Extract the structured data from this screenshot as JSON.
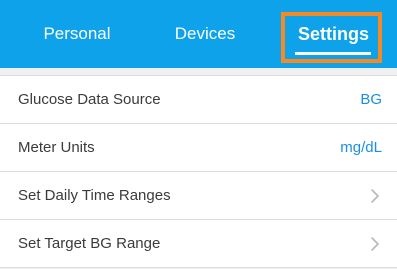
{
  "tabs": {
    "personal": "Personal",
    "devices": "Devices",
    "settings": "Settings"
  },
  "settings_list": [
    {
      "label": "Glucose Data Source",
      "value": "BG"
    },
    {
      "label": "Meter Units",
      "value": "mg/dL"
    },
    {
      "label": "Set Daily Time Ranges",
      "icon": "chevron-right-icon"
    },
    {
      "label": "Set Target BG Range",
      "icon": "chevron-right-icon"
    }
  ],
  "colors": {
    "tab_bar": "#0da2ea",
    "highlight": "#f58a24",
    "value_text": "#1a8fe3"
  }
}
